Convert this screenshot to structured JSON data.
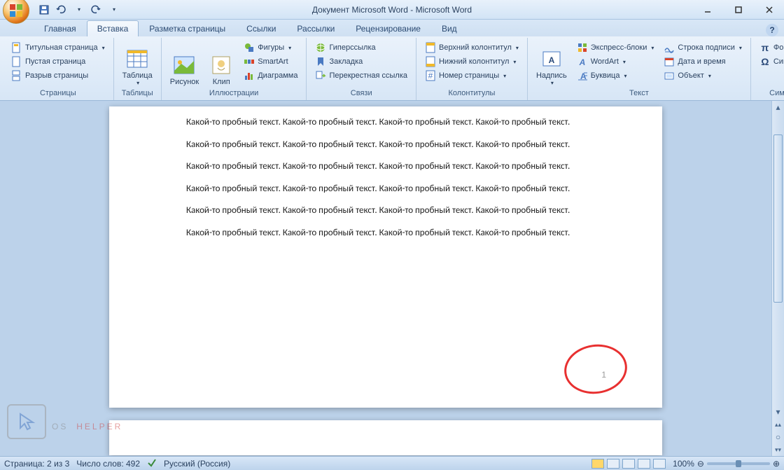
{
  "title": "Документ Microsoft Word - Microsoft Word",
  "tabs": {
    "home": "Главная",
    "insert": "Вставка",
    "pageLayout": "Разметка страницы",
    "references": "Ссылки",
    "mailings": "Рассылки",
    "review": "Рецензирование",
    "view": "Вид"
  },
  "ribbon": {
    "pages": {
      "label": "Страницы",
      "coverPage": "Титульная страница",
      "blankPage": "Пустая страница",
      "pageBreak": "Разрыв страницы"
    },
    "tables": {
      "label": "Таблицы",
      "table": "Таблица"
    },
    "illustrations": {
      "label": "Иллюстрации",
      "picture": "Рисунок",
      "clip": "Клип",
      "shapes": "Фигуры",
      "smartart": "SmartArt",
      "chart": "Диаграмма"
    },
    "links": {
      "label": "Связи",
      "hyperlink": "Гиперссылка",
      "bookmark": "Закладка",
      "crossref": "Перекрестная ссылка"
    },
    "headerFooter": {
      "label": "Колонтитулы",
      "header": "Верхний колонтитул",
      "footer": "Нижний колонтитул",
      "pageNumber": "Номер страницы"
    },
    "text": {
      "label": "Текст",
      "textbox": "Надпись",
      "quickParts": "Экспресс-блоки",
      "wordart": "WordArt",
      "dropCap": "Буквица",
      "sigLine": "Строка подписи",
      "dateTime": "Дата и время",
      "object": "Объект"
    },
    "symbols": {
      "label": "Символы",
      "equation": "Формула",
      "symbol": "Символ"
    }
  },
  "document": {
    "para": "Какой-то пробный текст. Какой-то пробный текст. Какой-то пробный текст. Какой-то пробный текст.",
    "pageNum": "1"
  },
  "status": {
    "page": "Страница: 2 из 3",
    "words": "Число слов: 492",
    "lang": "Русский (Россия)",
    "zoom": "100%"
  },
  "watermark": {
    "text1": "OS",
    "text2": "HELPER"
  }
}
